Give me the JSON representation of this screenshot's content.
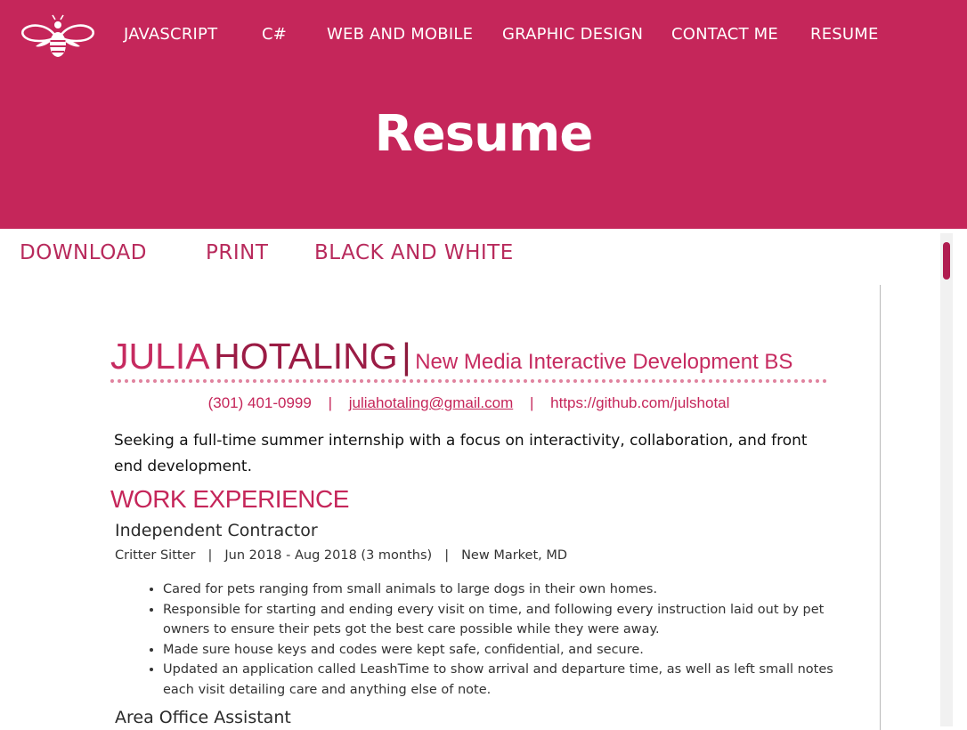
{
  "nav": {
    "items": [
      "JAVASCRIPT",
      "C#",
      "WEB AND MOBILE",
      "GRAPHIC DESIGN",
      "CONTACT ME",
      "RESUME"
    ]
  },
  "header": {
    "title": "Resume"
  },
  "actions": {
    "download": "DOWNLOAD",
    "print": "PRINT",
    "black_and_white": "BLACK AND WHITE"
  },
  "resume": {
    "first_name": "JULIA",
    "last_name": "HOTALING",
    "separator": "|",
    "degree": "New Media Interactive Development BS",
    "contact": {
      "phone": "(301) 401-0999",
      "email": "juliahotaling@gmail.com",
      "github": "https://github.com/julshotal",
      "sep": "|"
    },
    "objective": "Seeking a full-time summer internship with a focus on interactivity, collaboration, and front end development.",
    "work_heading": "WORK EXPERIENCE",
    "jobs": [
      {
        "title": "Independent Contractor",
        "role": "Critter Sitter",
        "dates": "Jun 2018 - Aug 2018 (3 months)",
        "location": "New Market, MD",
        "bullets": [
          "Cared for pets ranging from small animals to large dogs in their own homes.",
          "Responsible for starting and ending every visit on time, and following every instruction laid out by pet owners to ensure their pets got the best care possible while they were away.",
          "Made sure house keys and codes were kept safe, confidential, and secure.",
          "Updated an application called LeashTime to show arrival and departure time, as well as left small notes each visit detailing care and anything else of note."
        ]
      },
      {
        "title": "Area Office Assistant"
      }
    ]
  },
  "colors": {
    "brand": "#c5265a",
    "dark_accent": "#9b1c45",
    "dots": "#e0829e"
  },
  "icons": {
    "logo": "bee-logo-icon"
  }
}
